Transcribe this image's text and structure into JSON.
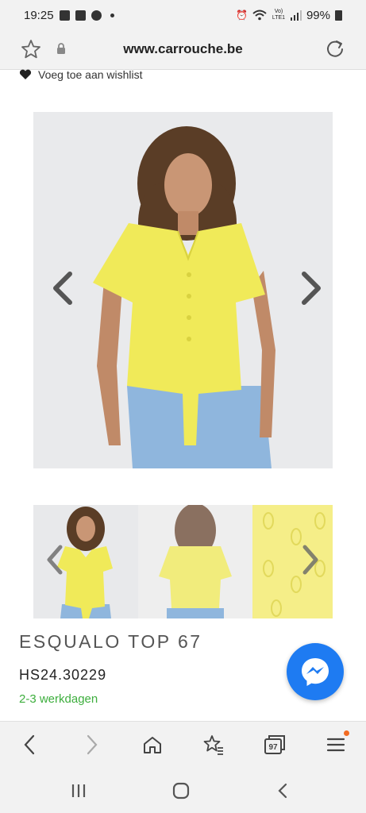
{
  "status_bar": {
    "time": "19:25",
    "battery": "99%",
    "network": "Vo) LTE1"
  },
  "browser": {
    "url": "www.carrouche.be",
    "tabs_count": "97",
    "notification_color": "#f26b21"
  },
  "product": {
    "wishlist_label": "Voeg toe aan wishlist",
    "title": "ESQUALO TOP 67",
    "sku": "HS24.30229",
    "delivery": "2-3 werkdagen",
    "delivery_color": "#3dae3d",
    "top_color": "#f0ea59",
    "jeans_color": "#8fb6dd"
  },
  "icons": {
    "messenger": "messenger-icon",
    "star": "star-icon",
    "lock": "lock-icon",
    "reload": "reload-icon",
    "heart": "heart-icon"
  },
  "accent": {
    "messenger_blue": "#1e7bf2"
  }
}
